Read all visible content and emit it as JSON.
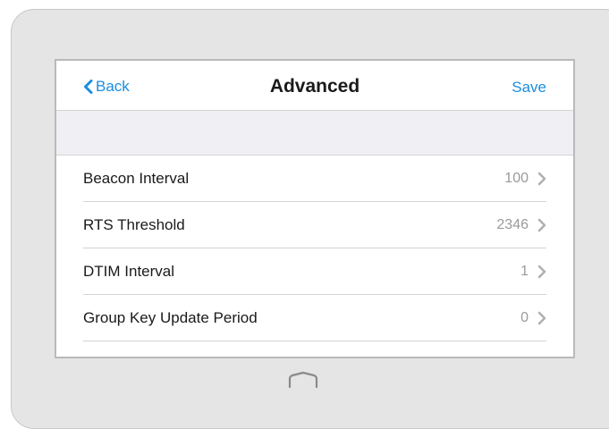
{
  "nav": {
    "back_label": "Back",
    "title": "Advanced",
    "save_label": "Save"
  },
  "settings": [
    {
      "label": "Beacon Interval",
      "value": "100"
    },
    {
      "label": "RTS Threshold",
      "value": "2346"
    },
    {
      "label": "DTIM Interval",
      "value": "1"
    },
    {
      "label": "Group Key Update Period",
      "value": "0"
    }
  ],
  "colors": {
    "accent": "#1a8ee0",
    "value_text": "#9a9a9a",
    "section_bg": "#efeff4",
    "device_frame": "#e5e5e5"
  },
  "icons": {
    "back": "chevron-left-icon",
    "row": "chevron-right-icon",
    "home": "home-button-icon"
  }
}
